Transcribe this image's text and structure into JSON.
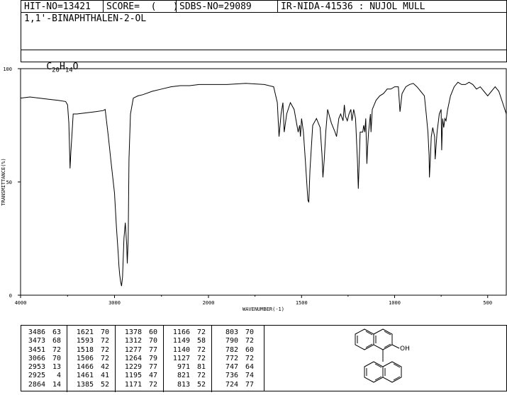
{
  "header": {
    "hit_no": "HIT-NO=13421",
    "score": "SCORE=  (   )",
    "sdbs_no": "SDBS-NO=29089",
    "ir_nida": "IR-NIDA-41536 : NUJOL MULL"
  },
  "compound": {
    "name": "1,1'-BINAPHTHALEN-2-OL",
    "formula_c": "C",
    "formula_c_sub": "20",
    "formula_h": "H",
    "formula_h_sub": "14",
    "formula_o": "O"
  },
  "chart_data": {
    "type": "line",
    "xlabel": "WAVENUMBER(-1)",
    "ylabel": "TRANSMITTANCE(%)",
    "x_ticks": [
      "4000",
      "3000",
      "2000",
      "1500",
      "1000",
      "500"
    ],
    "y_ticks": [
      "0",
      "50",
      "100"
    ],
    "ylim": [
      0,
      100
    ],
    "x_axis": "wavenumber, decreasing left to right; 4000-2000 compressed scale, 2000-400 expanded",
    "series": [
      {
        "x": [
          4000,
          3900,
          3800,
          3700,
          3600,
          3520,
          3500,
          3486,
          3473,
          3465,
          3451,
          3440,
          3400,
          3300,
          3200,
          3120,
          3100,
          3066,
          3040,
          3000,
          2980,
          2960,
          2953,
          2945,
          2935,
          2925,
          2915,
          2900,
          2885,
          2870,
          2864,
          2854,
          2846,
          2830,
          2800,
          2750,
          2700,
          2600,
          2500,
          2400,
          2300,
          2200,
          2100,
          2000,
          1900,
          1800,
          1700,
          1650,
          1630,
          1621,
          1610,
          1600,
          1593,
          1580,
          1560,
          1540,
          1518,
          1510,
          1506,
          1500,
          1490,
          1480,
          1466,
          1461,
          1455,
          1440,
          1420,
          1400,
          1390,
          1385,
          1378,
          1370,
          1360,
          1340,
          1320,
          1312,
          1300,
          1290,
          1277,
          1270,
          1264,
          1254,
          1245,
          1235,
          1229,
          1220,
          1210,
          1200,
          1195,
          1185,
          1171,
          1166,
          1160,
          1155,
          1149,
          1145,
          1140,
          1130,
          1127,
          1120,
          1100,
          1080,
          1060,
          1040,
          1020,
          1000,
          980,
          971,
          960,
          940,
          920,
          900,
          880,
          860,
          840,
          830,
          821,
          815,
          813,
          808,
          803,
          795,
          790,
          785,
          782,
          778,
          772,
          760,
          750,
          747,
          742,
          736,
          730,
          724,
          715,
          700,
          680,
          660,
          640,
          620,
          600,
          580,
          560,
          540,
          520,
          500,
          480,
          460,
          440,
          420,
          400
        ],
        "y": [
          87,
          87.5,
          87,
          86.5,
          86,
          85.5,
          84,
          76,
          56,
          63,
          72,
          80,
          80,
          80.5,
          81,
          81.5,
          82,
          70,
          60,
          45,
          30,
          18,
          13,
          9,
          6,
          4,
          8,
          25,
          32,
          22,
          14,
          25,
          60,
          80,
          87,
          88,
          88.5,
          90,
          91,
          92,
          92.5,
          92.5,
          93,
          93,
          93,
          93.5,
          93,
          92,
          85,
          70,
          80,
          85,
          72,
          80,
          85,
          82,
          72,
          75,
          70,
          78,
          72,
          60,
          42,
          41,
          55,
          75,
          78,
          74,
          62,
          52,
          60,
          72,
          82,
          76,
          72,
          70,
          78,
          80,
          77,
          84,
          79,
          77,
          80,
          82,
          77,
          82,
          78,
          60,
          47,
          72,
          72,
          75,
          72,
          78,
          58,
          65,
          72,
          80,
          72,
          82,
          86,
          88,
          89,
          91,
          91,
          92,
          92,
          81,
          89,
          92,
          93,
          93.5,
          92,
          90,
          88,
          80,
          72,
          62,
          52,
          60,
          70,
          74,
          72,
          70,
          60,
          65,
          72,
          80,
          82,
          64,
          78,
          74,
          78,
          77,
          82,
          88,
          92,
          94,
          93,
          93,
          94,
          93,
          91,
          92,
          90,
          88,
          90,
          92,
          90,
          85,
          80
        ]
      }
    ]
  },
  "peak_table": {
    "col1": [
      [
        "3486",
        "63"
      ],
      [
        "3473",
        "68"
      ],
      [
        "3451",
        "72"
      ],
      [
        "3066",
        "70"
      ],
      [
        "2953",
        "13"
      ],
      [
        "2925",
        "4"
      ],
      [
        "2864",
        "14"
      ]
    ],
    "col2": [
      [
        "1621",
        "70"
      ],
      [
        "1593",
        "72"
      ],
      [
        "1518",
        "72"
      ],
      [
        "1506",
        "72"
      ],
      [
        "1466",
        "42"
      ],
      [
        "1461",
        "41"
      ],
      [
        "1385",
        "52"
      ]
    ],
    "col3": [
      [
        "1378",
        "60"
      ],
      [
        "1312",
        "70"
      ],
      [
        "1277",
        "77"
      ],
      [
        "1264",
        "79"
      ],
      [
        "1229",
        "77"
      ],
      [
        "1195",
        "47"
      ],
      [
        "1171",
        "72"
      ]
    ],
    "col4": [
      [
        "1166",
        "72"
      ],
      [
        "1149",
        "58"
      ],
      [
        "1140",
        "72"
      ],
      [
        "1127",
        "72"
      ],
      [
        "971",
        "81"
      ],
      [
        "821",
        "72"
      ],
      [
        "813",
        "52"
      ]
    ],
    "col5": [
      [
        "803",
        "70"
      ],
      [
        "790",
        "72"
      ],
      [
        "782",
        "60"
      ],
      [
        "772",
        "72"
      ],
      [
        "747",
        "64"
      ],
      [
        "736",
        "74"
      ],
      [
        "724",
        "77"
      ]
    ]
  },
  "structure": {
    "oh_label": "OH"
  }
}
